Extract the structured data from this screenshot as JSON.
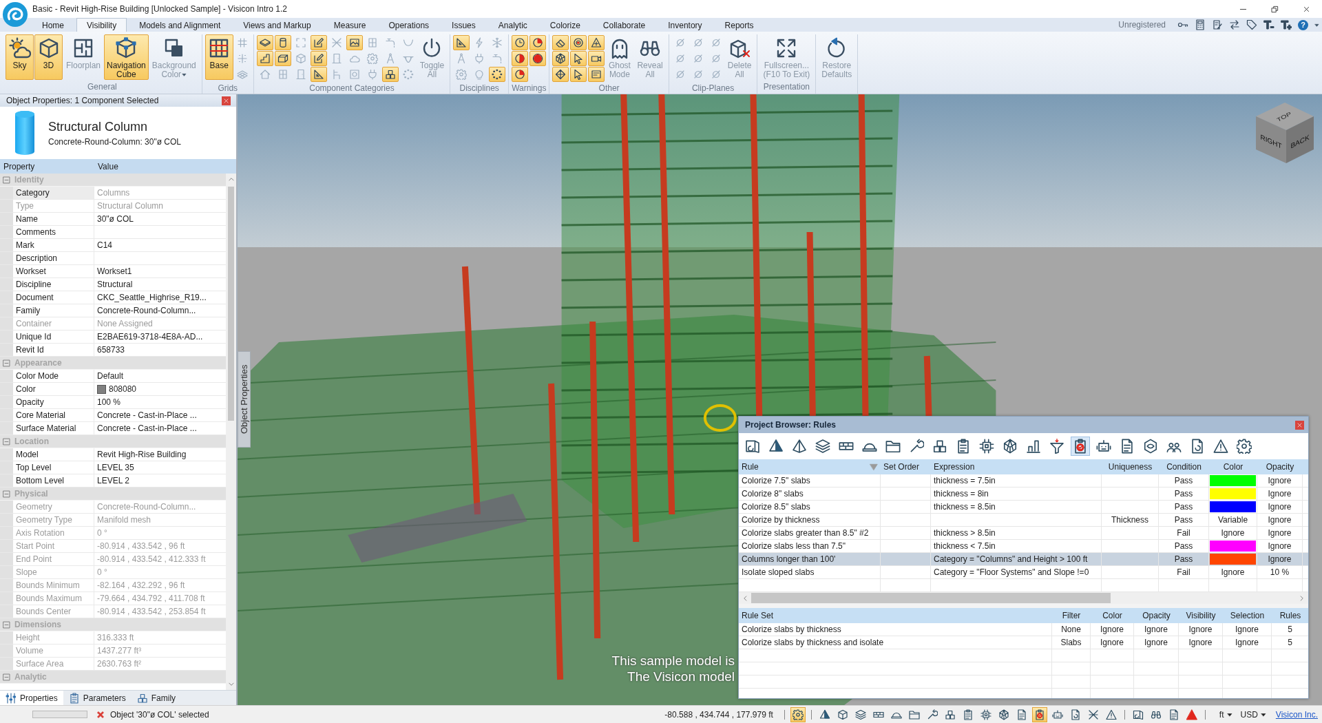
{
  "window": {
    "title": "Basic - Revit High-Rise Building [Unlocked Sample] - Visicon Intro 1.2"
  },
  "menu_tabs": [
    {
      "label": "Home",
      "selected": false
    },
    {
      "label": "Visibility",
      "selected": true
    },
    {
      "label": "Models and Alignment",
      "selected": false
    },
    {
      "label": "Views and Markup",
      "selected": false
    },
    {
      "label": "Measure",
      "selected": false
    },
    {
      "label": "Operations",
      "selected": false
    },
    {
      "label": "Issues",
      "selected": false
    },
    {
      "label": "Analytic",
      "selected": false
    },
    {
      "label": "Colorize",
      "selected": false
    },
    {
      "label": "Collaborate",
      "selected": false
    },
    {
      "label": "Inventory",
      "selected": false
    },
    {
      "label": "Reports",
      "selected": false
    }
  ],
  "account": {
    "status": "Unregistered",
    "help": "?"
  },
  "ribbon": {
    "groups": [
      {
        "label": "General",
        "items": [
          {
            "kind": "large",
            "label": "Sky",
            "on": true
          },
          {
            "kind": "large",
            "label": "3D",
            "on": true
          },
          {
            "kind": "large",
            "label": "Floorplan",
            "on": false
          },
          {
            "kind": "large",
            "label": "Navigation\nCube",
            "on": true
          },
          {
            "kind": "dropdown",
            "label": "Background\nColor",
            "on": false
          }
        ]
      },
      {
        "label": "Grids",
        "items": [
          {
            "kind": "large",
            "label": "Base",
            "on": true
          },
          {
            "kind": "small",
            "on": false
          },
          {
            "kind": "small",
            "on": false
          },
          {
            "kind": "small",
            "on": false
          }
        ]
      },
      {
        "label": "Component Categories",
        "items": [
          {
            "kind": "small",
            "on": true
          },
          {
            "kind": "small",
            "on": true
          },
          {
            "kind": "small",
            "on": false
          },
          {
            "kind": "small",
            "on": true
          },
          {
            "kind": "small",
            "on": true
          },
          {
            "kind": "small",
            "on": false
          },
          {
            "kind": "small",
            "on": false
          },
          {
            "kind": "small",
            "on": false
          },
          {
            "kind": "small",
            "on": false
          },
          {
            "kind": "small",
            "on": true
          },
          {
            "kind": "small",
            "on": true
          },
          {
            "kind": "small",
            "on": true
          },
          {
            "kind": "small",
            "on": false
          },
          {
            "kind": "small",
            "on": false
          },
          {
            "kind": "small",
            "on": false
          },
          {
            "kind": "small",
            "on": true
          },
          {
            "kind": "small",
            "on": false
          },
          {
            "kind": "small",
            "on": false
          },
          {
            "kind": "small",
            "on": false
          },
          {
            "kind": "small",
            "on": false
          },
          {
            "kind": "small",
            "on": false
          },
          {
            "kind": "small",
            "on": false
          },
          {
            "kind": "small",
            "on": false
          },
          {
            "kind": "small",
            "on": true
          },
          {
            "kind": "small",
            "on": false
          },
          {
            "kind": "small",
            "on": false
          },
          {
            "kind": "small",
            "on": false
          },
          {
            "kind": "large",
            "label": "Toggle\nAll",
            "on": false
          }
        ]
      },
      {
        "label": "Disciplines",
        "items": [
          {
            "kind": "small",
            "on": true
          },
          {
            "kind": "small",
            "on": false
          },
          {
            "kind": "small",
            "on": false
          },
          {
            "kind": "small",
            "on": false
          },
          {
            "kind": "small",
            "on": false
          },
          {
            "kind": "small",
            "on": false
          },
          {
            "kind": "small",
            "on": false
          },
          {
            "kind": "small",
            "on": false
          },
          {
            "kind": "small",
            "on": true
          }
        ]
      },
      {
        "label": "Warnings",
        "items": [
          {
            "kind": "small",
            "on": true
          },
          {
            "kind": "small",
            "on": true
          },
          {
            "kind": "small",
            "on": true
          },
          {
            "kind": "small",
            "on": true
          },
          {
            "kind": "small",
            "on": true
          }
        ]
      },
      {
        "label": "Other",
        "items": [
          {
            "kind": "small",
            "on": true
          },
          {
            "kind": "small",
            "on": true
          },
          {
            "kind": "small",
            "on": true
          },
          {
            "kind": "small",
            "on": true
          },
          {
            "kind": "small",
            "on": true
          },
          {
            "kind": "small",
            "on": true
          },
          {
            "kind": "small",
            "on": true
          },
          {
            "kind": "small",
            "on": true
          },
          {
            "kind": "small",
            "on": true
          },
          {
            "kind": "large",
            "label": "Ghost\nMode",
            "on": false
          },
          {
            "kind": "large",
            "label": "Reveal\nAll",
            "on": false
          }
        ]
      },
      {
        "label": "Clip-Planes",
        "items": [
          {
            "kind": "small",
            "on": false
          },
          {
            "kind": "small",
            "on": false
          },
          {
            "kind": "small",
            "on": false
          },
          {
            "kind": "small",
            "on": false
          },
          {
            "kind": "small",
            "on": false
          },
          {
            "kind": "small",
            "on": false
          },
          {
            "kind": "small",
            "on": false
          },
          {
            "kind": "small",
            "on": false
          },
          {
            "kind": "small",
            "on": false
          },
          {
            "kind": "large",
            "label": "Delete\nAll",
            "on": false
          }
        ]
      },
      {
        "label": "Presentation",
        "items": [
          {
            "kind": "large",
            "label": "Fullscreen...\n(F10 To Exit)",
            "on": false
          }
        ]
      },
      {
        "items": [
          {
            "kind": "large",
            "label": "Restore\nDefaults",
            "on": false
          }
        ]
      }
    ]
  },
  "properties_panel": {
    "title": "Object Properties: 1 Component Selected",
    "object": {
      "type": "Structural Column",
      "name": "Concrete-Round-Column: 30\"ø COL"
    },
    "columns": [
      "Property",
      "Value"
    ],
    "groups": [
      {
        "name": "Identity",
        "expanded": true,
        "rows": [
          {
            "property": "Category",
            "value": "Columns",
            "readonly": true,
            "selected": true
          },
          {
            "property": "Type",
            "value": "Structural Column",
            "readonly": true,
            "selected": false
          },
          {
            "property": "Name",
            "value": "30\"ø COL",
            "readonly": false,
            "selected": false
          },
          {
            "property": "Comments",
            "readonly": false,
            "selected": false
          },
          {
            "property": "Mark",
            "value": "C14",
            "readonly": false,
            "selected": false
          },
          {
            "property": "Description",
            "readonly": false,
            "selected": false
          },
          {
            "property": "Workset",
            "value": "Workset1",
            "readonly": false,
            "selected": false
          },
          {
            "property": "Discipline",
            "value": "Structural",
            "readonly": false,
            "selected": false
          },
          {
            "property": "Document",
            "value": "CKC_Seattle_Highrise_R19...",
            "readonly": false,
            "selected": false
          },
          {
            "property": "Family",
            "value": "Concrete-Round-Column...",
            "readonly": false,
            "selected": false
          },
          {
            "property": "Container",
            "value": "None Assigned",
            "readonly": true,
            "selected": false
          },
          {
            "property": "Unique Id",
            "value": "E2BAE619-3718-4E8A-AD...",
            "readonly": false,
            "selected": false
          },
          {
            "property": "Revit Id",
            "value": "658733",
            "readonly": false,
            "selected": false
          }
        ]
      },
      {
        "name": "Appearance",
        "expanded": true,
        "rows": [
          {
            "property": "Color Mode",
            "value": "Default",
            "readonly": false,
            "selected": false
          },
          {
            "property": "Color",
            "value": "808080",
            "color": "#808080",
            "readonly": false,
            "selected": false
          },
          {
            "property": "Opacity",
            "value": "100 %",
            "readonly": false,
            "selected": false
          },
          {
            "property": "Core Material",
            "value": "Concrete - Cast-in-Place ...",
            "readonly": false,
            "selected": false
          },
          {
            "property": "Surface Material",
            "value": "Concrete - Cast-in-Place ...",
            "readonly": false,
            "selected": false
          }
        ]
      },
      {
        "name": "Location",
        "expanded": true,
        "rows": [
          {
            "property": "Model",
            "value": "Revit High-Rise Building",
            "readonly": false,
            "selected": false
          },
          {
            "property": "Top Level",
            "value": "LEVEL 35",
            "readonly": false,
            "selected": false
          },
          {
            "property": "Bottom Level",
            "value": "LEVEL 2",
            "readonly": false,
            "selected": false
          }
        ]
      },
      {
        "name": "Physical",
        "expanded": true,
        "rows": [
          {
            "property": "Geometry",
            "value": "Concrete-Round-Column...",
            "readonly": true,
            "selected": false
          },
          {
            "property": "Geometry Type",
            "value": "Manifold mesh",
            "readonly": true,
            "selected": false
          },
          {
            "property": "Axis Rotation",
            "value": "0 °",
            "readonly": true,
            "selected": false
          },
          {
            "property": "Start Point",
            "value": "-80.914 , 433.542 , 96 ft",
            "readonly": true,
            "selected": false
          },
          {
            "property": "End Point",
            "value": "-80.914 , 433.542 , 412.333 ft",
            "readonly": true,
            "selected": false
          },
          {
            "property": "Slope",
            "value": "0 °",
            "readonly": true,
            "selected": false
          },
          {
            "property": "Bounds Minimum",
            "value": "-82.164 , 432.292 , 96 ft",
            "readonly": true,
            "selected": false
          },
          {
            "property": "Bounds Maximum",
            "value": "-79.664 , 434.792 , 411.708 ft",
            "readonly": true,
            "selected": false
          },
          {
            "property": "Bounds Center",
            "value": "-80.914 , 433.542 , 253.854 ft",
            "readonly": true,
            "selected": false
          }
        ]
      },
      {
        "name": "Dimensions",
        "expanded": true,
        "rows": [
          {
            "property": "Height",
            "value": "316.333 ft",
            "readonly": true,
            "selected": false
          },
          {
            "property": "Volume",
            "value": "1437.277 ft³",
            "readonly": true,
            "selected": false
          },
          {
            "property": "Surface Area",
            "value": "2630.763 ft²",
            "readonly": true,
            "selected": false
          }
        ]
      },
      {
        "name": "Analytic",
        "expanded": true
      }
    ],
    "tabs": [
      {
        "label": "Properties",
        "selected": true
      },
      {
        "label": "Parameters",
        "selected": false
      },
      {
        "label": "Family",
        "selected": false
      }
    ]
  },
  "viewport": {
    "side_tab": "Object Properties",
    "nav_cube": [
      "TOP",
      "RIGHT",
      "BACK"
    ],
    "captions": [
      "This sample model is",
      "The Visicon model"
    ]
  },
  "rules_browser": {
    "title": "Project Browser: Rules",
    "toolbar": [
      {
        "selected": false
      },
      {
        "selected": false
      },
      {
        "selected": false
      },
      {
        "selected": false
      },
      {
        "selected": false
      },
      {
        "selected": false
      },
      {
        "selected": false
      },
      {
        "selected": false
      },
      {
        "selected": false
      },
      {
        "selected": false
      },
      {
        "selected": false
      },
      {
        "selected": false
      },
      {
        "selected": false
      },
      {
        "selected": false
      },
      {
        "selected": true
      },
      {
        "selected": false
      },
      {
        "selected": false
      },
      {
        "selected": false
      },
      {
        "selected": false
      },
      {
        "selected": false
      },
      {
        "selected": false
      },
      {
        "selected": false
      }
    ],
    "rules": {
      "columns": [
        {
          "label": "Rule",
          "sorted": true
        },
        {
          "label": "Set Order",
          "sorted": false
        },
        {
          "label": "Expression",
          "sorted": false
        },
        {
          "label": "Uniqueness",
          "sorted": false
        },
        {
          "label": "Condition",
          "sorted": false
        },
        {
          "label": "Color",
          "sorted": false
        },
        {
          "label": "Opacity",
          "sorted": false
        }
      ],
      "rows": [
        {
          "rule": "Colorize 7.5\" slabs",
          "expression": "thickness = 7.5in",
          "condition": "Pass",
          "color": "#00ff00",
          "opacity": "Ignore",
          "selected": false
        },
        {
          "rule": "Colorize 8\" slabs",
          "expression": "thickness = 8in",
          "condition": "Pass",
          "color": "#ffff00",
          "opacity": "Ignore",
          "selected": false
        },
        {
          "rule": "Colorize 8.5\" slabs",
          "expression": "thickness = 8.5in",
          "condition": "Pass",
          "color": "#0000ff",
          "opacity": "Ignore",
          "selected": false
        },
        {
          "rule": "Colorize by thickness",
          "uniqueness": "Thickness",
          "condition": "Pass",
          "color_label": "Variable",
          "opacity": "Ignore",
          "selected": false
        },
        {
          "rule": "Colorize slabs greater than 8.5\" #2",
          "expression": "thickness > 8.5in",
          "condition": "Fail",
          "color_label": "Ignore",
          "opacity": "Ignore",
          "selected": false
        },
        {
          "rule": "Colorize slabs less than 7.5\"",
          "expression": "thickness < 7.5in",
          "condition": "Pass",
          "color": "#ff00ff",
          "opacity": "Ignore",
          "selected": false
        },
        {
          "rule": "Columns longer than 100'",
          "expression": "Category = \"Columns\" and Height > 100 ft",
          "condition": "Pass",
          "color": "#ff4500",
          "opacity": "Ignore",
          "selected": true
        },
        {
          "rule": "Isolate sloped slabs",
          "expression": "Category = \"Floor Systems\" and Slope !=0",
          "condition": "Fail",
          "color_label": "Ignore",
          "opacity": "10 %",
          "selected": false
        }
      ]
    },
    "rule_sets": {
      "columns": [
        "Rule Set",
        "Filter",
        "Color",
        "Opacity",
        "Visibility",
        "Selection",
        "Rules"
      ],
      "rows": [
        {
          "cells": [
            "Colorize slabs by thickness",
            "None",
            "Ignore",
            "Ignore",
            "Ignore",
            "Ignore",
            "5"
          ],
          "selected": false
        },
        {
          "cells": [
            "Colorize slabs by thickness and isolate",
            "Slabs",
            "Ignore",
            "Ignore",
            "Ignore",
            "Ignore",
            "5"
          ],
          "selected": false
        }
      ]
    }
  },
  "status_bar": {
    "progress": {
      "level": 0
    },
    "message": "Object '30\"ø COL' selected",
    "coordinates": "-80.588 , 434.744 , 177.979 ft",
    "tool_groups": [
      [
        {
          "selected": true
        }
      ],
      [
        {
          "selected": false
        },
        {
          "selected": false
        },
        {
          "selected": false
        },
        {
          "selected": false
        },
        {
          "selected": false
        },
        {
          "selected": false
        },
        {
          "selected": false
        },
        {
          "selected": false
        },
        {
          "selected": false
        },
        {
          "selected": false
        },
        {
          "selected": false
        },
        {
          "selected": false
        },
        {
          "selected": true
        },
        {
          "selected": false
        },
        {
          "selected": false
        },
        {
          "selected": false
        },
        {
          "selected": false
        }
      ],
      [
        {
          "selected": false
        },
        {
          "selected": false
        },
        {
          "selected": false
        },
        {
          "selected": false
        }
      ]
    ],
    "units": "ft",
    "currency": "USD",
    "link": "Visicon Inc."
  }
}
